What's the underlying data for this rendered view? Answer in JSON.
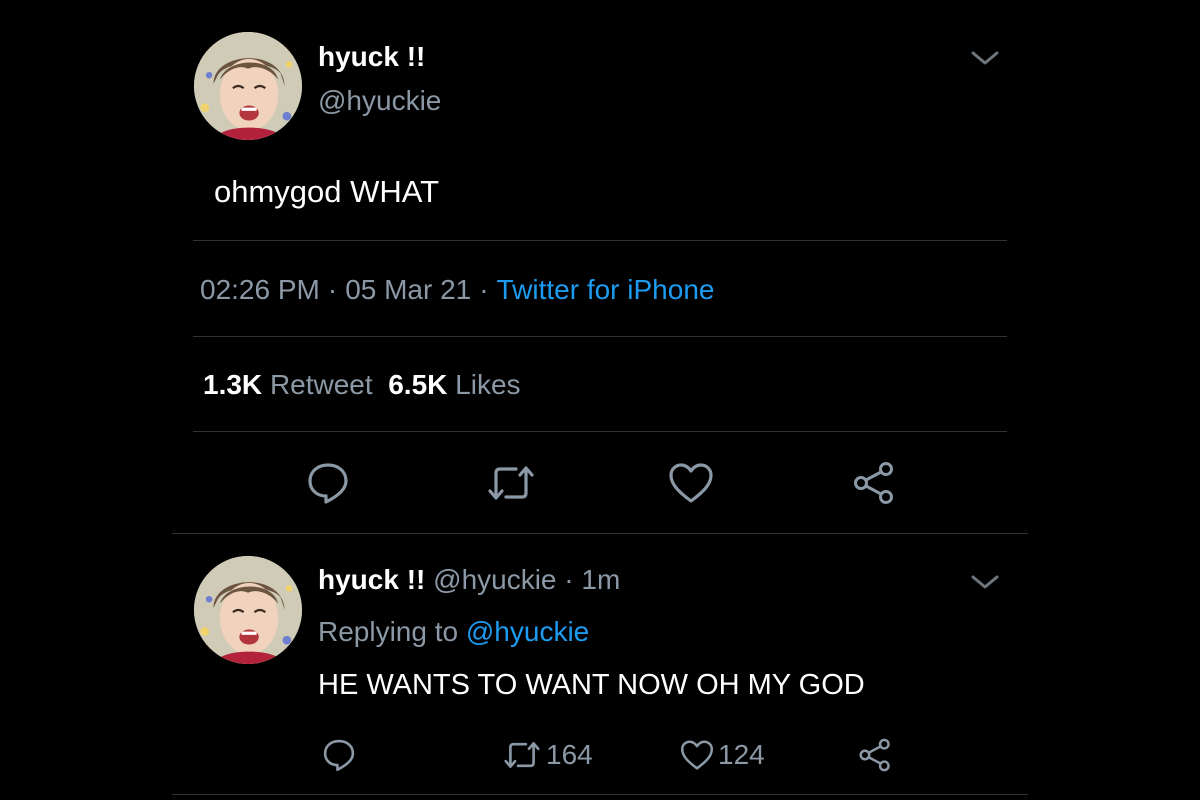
{
  "main_tweet": {
    "display_name": "hyuck !!",
    "handle": "@hyuckie",
    "text": "ohmygod WHAT",
    "time": "02:26 PM",
    "date": "05 Mar 21",
    "separator": "·",
    "source": "Twitter for iPhone",
    "retweet_count": "1.3K",
    "retweet_label": "Retweet",
    "like_count": "6.5K",
    "like_label": "Likes",
    "actions": [
      "reply-icon",
      "retweet-icon",
      "like-icon",
      "share-icon"
    ]
  },
  "reply_tweet": {
    "display_name": "hyuck !!",
    "handle": "@hyuckie",
    "separator": "·",
    "time": "1m",
    "replying_to_label": "Replying to",
    "replying_to_handle": "@hyuckie",
    "text": "HE WANTS TO WANT NOW OH MY GOD",
    "retweet_count": "164",
    "like_count": "124",
    "actions": [
      "reply-icon",
      "retweet-icon",
      "like-icon",
      "share-icon"
    ]
  },
  "colors": {
    "background": "#000000",
    "primary_text": "#ffffff",
    "secondary_text": "#8b98a5",
    "link": "#1d9bf0",
    "divider": "#2f3336"
  }
}
